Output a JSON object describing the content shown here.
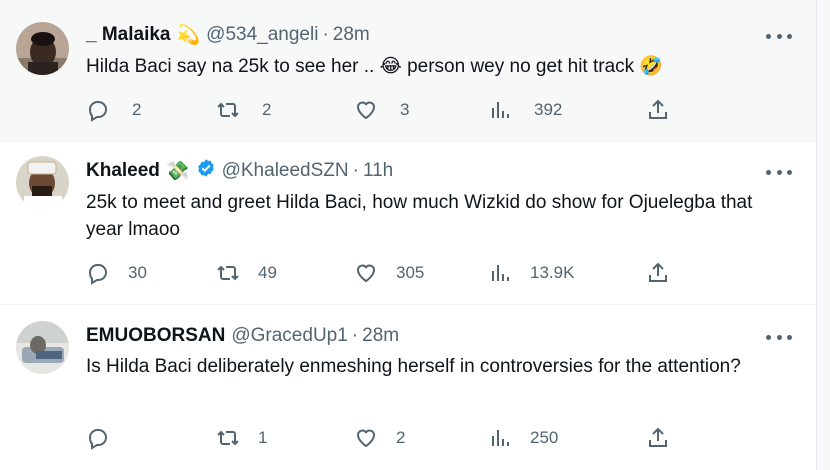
{
  "tweets": [
    {
      "name": "_ Malaika",
      "badge_emoji": "💫",
      "handle": "@534_angeli",
      "time": "28m",
      "text": "Hilda Baci say na 25k to see her .. 😂 person wey no get hit track 🤣",
      "replies": "2",
      "retweets": "2",
      "likes": "3",
      "views": "392"
    },
    {
      "name": "Khaleed",
      "badge_emoji": "💸",
      "verified": true,
      "handle": "@KhaleedSZN",
      "time": "11h",
      "text": "25k to meet and greet Hilda Baci, how much Wizkid do show for Ojuelegba that year lmaoo",
      "replies": "30",
      "retweets": "49",
      "likes": "305",
      "views": "13.9K"
    },
    {
      "name": "EMUOBORSAN",
      "handle": "@GracedUp1",
      "time": "28m",
      "text": "Is Hilda Baci deliberately enmeshing herself in controversies  for the attention?",
      "replies": "",
      "retweets": "1",
      "likes": "2",
      "views": "250"
    }
  ],
  "colors": {
    "accent": "#1d9bf0",
    "muted": "#536471",
    "text": "#0f1419",
    "hover_bg": "#f7f9f9"
  }
}
